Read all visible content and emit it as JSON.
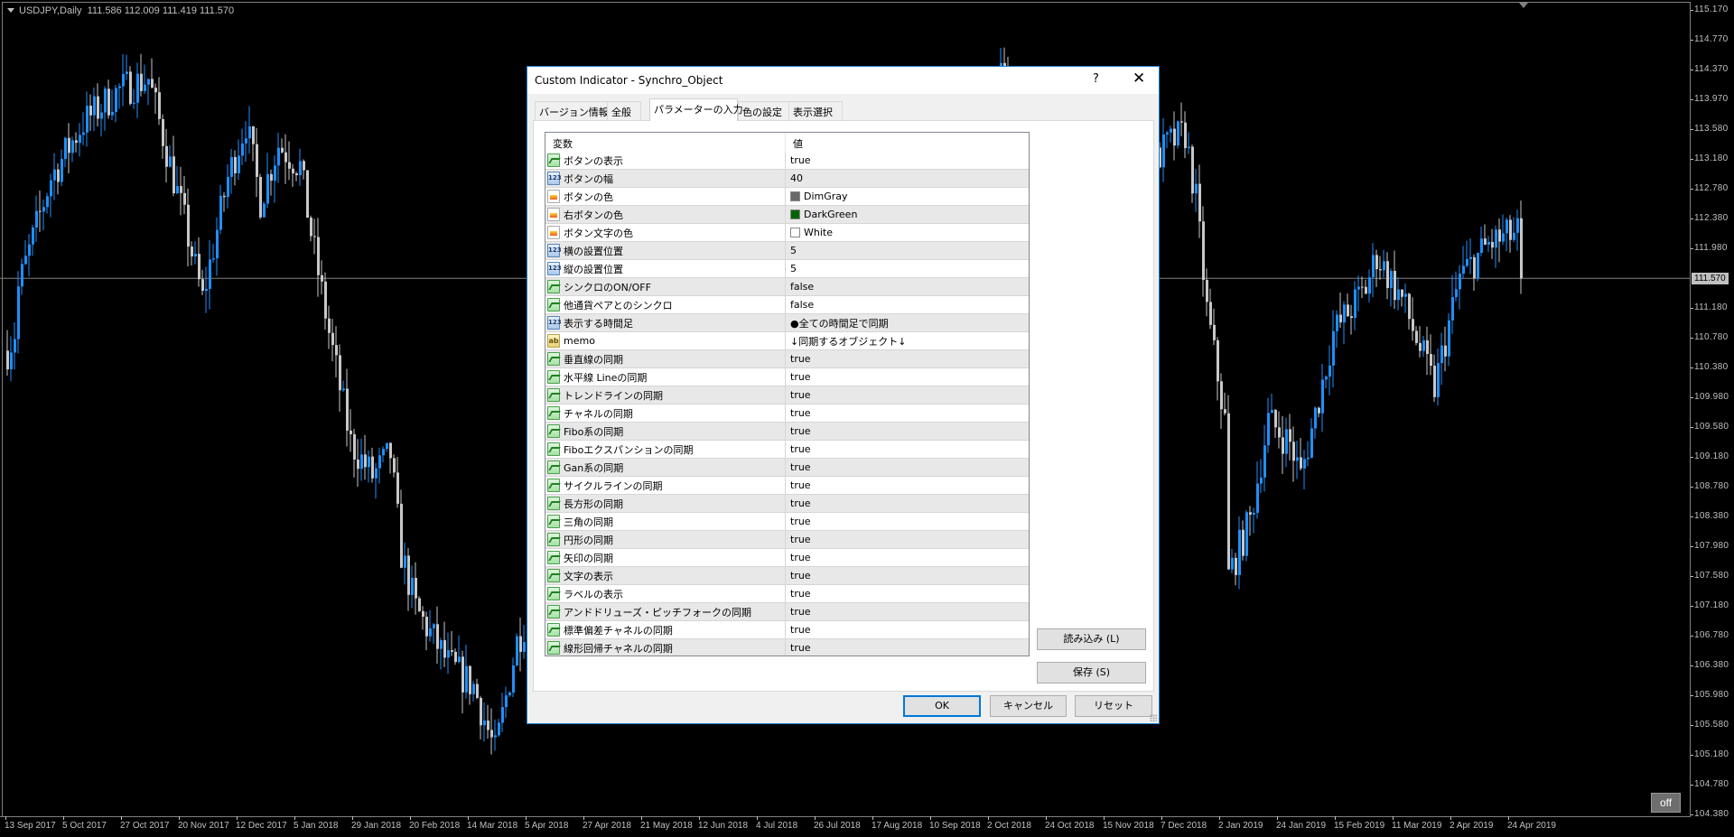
{
  "chart": {
    "symbol_label": "USDJPY,Daily",
    "ohlc": "111.586 112.009 111.419 111.570",
    "current_price": "111.570",
    "off_button": "off",
    "colors": {
      "bull": "#1e90ff",
      "bear": "#c8c8c8",
      "background": "#000000",
      "price_line": "#808080"
    },
    "price_axis": [
      "115.170",
      "114.770",
      "114.370",
      "113.970",
      "113.580",
      "113.180",
      "112.780",
      "112.380",
      "111.980",
      "111.570",
      "111.180",
      "110.780",
      "110.380",
      "109.980",
      "109.580",
      "109.180",
      "108.780",
      "108.380",
      "107.980",
      "107.580",
      "107.180",
      "106.780",
      "106.380",
      "105.980",
      "105.580",
      "105.180",
      "104.780",
      "104.380"
    ],
    "time_axis": [
      "13 Sep 2017",
      "5 Oct 2017",
      "27 Oct 2017",
      "20 Nov 2017",
      "12 Dec 2017",
      "5 Jan 2018",
      "29 Jan 2018",
      "20 Feb 2018",
      "14 Mar 2018",
      "5 Apr 2018",
      "27 Apr 2018",
      "21 May 2018",
      "12 Jun 2018",
      "4 Jul 2018",
      "26 Jul 2018",
      "17 Aug 2018",
      "10 Sep 2018",
      "2 Oct 2018",
      "24 Oct 2018",
      "15 Nov 2018",
      "7 Dec 2018",
      "2 Jan 2019",
      "24 Jan 2019",
      "15 Feb 2019",
      "11 Mar 2019",
      "2 Apr 2019",
      "24 Apr 2019"
    ],
    "price_range": [
      104.38,
      115.17
    ],
    "bars_per_time_label": 16,
    "price_path": [
      [
        0,
        110.6
      ],
      [
        2,
        110.84
      ],
      [
        3,
        111.44
      ],
      [
        12,
        112.92
      ],
      [
        21,
        113.66
      ],
      [
        31,
        114.1
      ],
      [
        39,
        114.25
      ],
      [
        49,
        112.33
      ],
      [
        54,
        111.29
      ],
      [
        61,
        112.92
      ],
      [
        66,
        113.66
      ],
      [
        70,
        112.62
      ],
      [
        75,
        113.36
      ],
      [
        81,
        113.07
      ],
      [
        84,
        112.18
      ],
      [
        89,
        110.84
      ],
      [
        95,
        109.36
      ],
      [
        101,
        108.92
      ],
      [
        106,
        109.21
      ],
      [
        109,
        107.88
      ],
      [
        113,
        107.14
      ],
      [
        122,
        106.4
      ],
      [
        129,
        106.1
      ],
      [
        135,
        105.21
      ],
      [
        141,
        106.7
      ],
      [
        145,
        107.14
      ],
      [
        184,
        108.62
      ],
      [
        230,
        110.84
      ],
      [
        275,
        114.25
      ],
      [
        306,
        112.33
      ],
      [
        321,
        113.36
      ],
      [
        326,
        113.51
      ],
      [
        329,
        112.62
      ],
      [
        332,
        111.14
      ],
      [
        337,
        109.66
      ],
      [
        338,
        107.58
      ],
      [
        344,
        108.33
      ],
      [
        349,
        109.66
      ],
      [
        355,
        109.36
      ],
      [
        358,
        108.92
      ],
      [
        363,
        109.96
      ],
      [
        367,
        110.84
      ],
      [
        376,
        111.44
      ],
      [
        379,
        111.88
      ],
      [
        386,
        111.29
      ],
      [
        395,
        110.1
      ],
      [
        402,
        111.59
      ],
      [
        410,
        112.03
      ],
      [
        418,
        112.18
      ],
      [
        419,
        111.57
      ]
    ]
  },
  "dialog": {
    "title": "Custom Indicator - Synchro_Object",
    "help": "?",
    "close": "✕",
    "tabs": [
      "バージョン情報",
      "全般",
      "パラメーターの入力",
      "色の設定",
      "表示選択"
    ],
    "grid_headers": [
      "変数",
      "値"
    ],
    "params": [
      {
        "type": "bool",
        "name": "ボタンの表示",
        "value": "true"
      },
      {
        "type": "int",
        "name": "ボタンの幅",
        "value": "40"
      },
      {
        "type": "color",
        "name": "ボタンの色",
        "value": "DimGray",
        "swatch": "#696969"
      },
      {
        "type": "color",
        "name": "右ボタンの色",
        "value": "DarkGreen",
        "swatch": "#006400"
      },
      {
        "type": "color",
        "name": "ボタン文字の色",
        "value": "White",
        "swatch": "#ffffff"
      },
      {
        "type": "int",
        "name": "横の設置位置",
        "value": "5"
      },
      {
        "type": "int",
        "name": "縦の設置位置",
        "value": "5"
      },
      {
        "type": "bool",
        "name": "シンクロのON/OFF",
        "value": "false"
      },
      {
        "type": "bool",
        "name": "他通貨ペアとのシンクロ",
        "value": "false"
      },
      {
        "type": "int",
        "name": "表示する時間足",
        "value": "●全ての時間足で同期"
      },
      {
        "type": "str",
        "name": "memo",
        "value": "↓同期するオブジェクト↓"
      },
      {
        "type": "bool",
        "name": "垂直線の同期",
        "value": "true"
      },
      {
        "type": "bool",
        "name": "水平線 Lineの同期",
        "value": "true"
      },
      {
        "type": "bool",
        "name": "トレンドラインの同期",
        "value": "true"
      },
      {
        "type": "bool",
        "name": "チャネルの同期",
        "value": "true"
      },
      {
        "type": "bool",
        "name": "Fibo系の同期",
        "value": "true"
      },
      {
        "type": "bool",
        "name": "Fiboエクスパンションの同期",
        "value": "true"
      },
      {
        "type": "bool",
        "name": "Gan系の同期",
        "value": "true"
      },
      {
        "type": "bool",
        "name": "サイクルラインの同期",
        "value": "true"
      },
      {
        "type": "bool",
        "name": "長方形の同期",
        "value": "true"
      },
      {
        "type": "bool",
        "name": "三角の同期",
        "value": "true"
      },
      {
        "type": "bool",
        "name": "円形の同期",
        "value": "true"
      },
      {
        "type": "bool",
        "name": "矢印の同期",
        "value": "true"
      },
      {
        "type": "bool",
        "name": "文字の表示",
        "value": "true"
      },
      {
        "type": "bool",
        "name": "ラベルの表示",
        "value": "true"
      },
      {
        "type": "bool",
        "name": "アンドドリューズ・ピッチフォークの同期",
        "value": "true"
      },
      {
        "type": "bool",
        "name": "標準偏差チャネルの同期",
        "value": "true"
      },
      {
        "type": "bool",
        "name": "線形回帰チャネルの同期",
        "value": "true"
      }
    ],
    "load_button": "読み込み (L)",
    "save_button": "保存 (S)",
    "ok_button": "OK",
    "cancel_button": "キャンセル",
    "reset_button": "リセット"
  }
}
